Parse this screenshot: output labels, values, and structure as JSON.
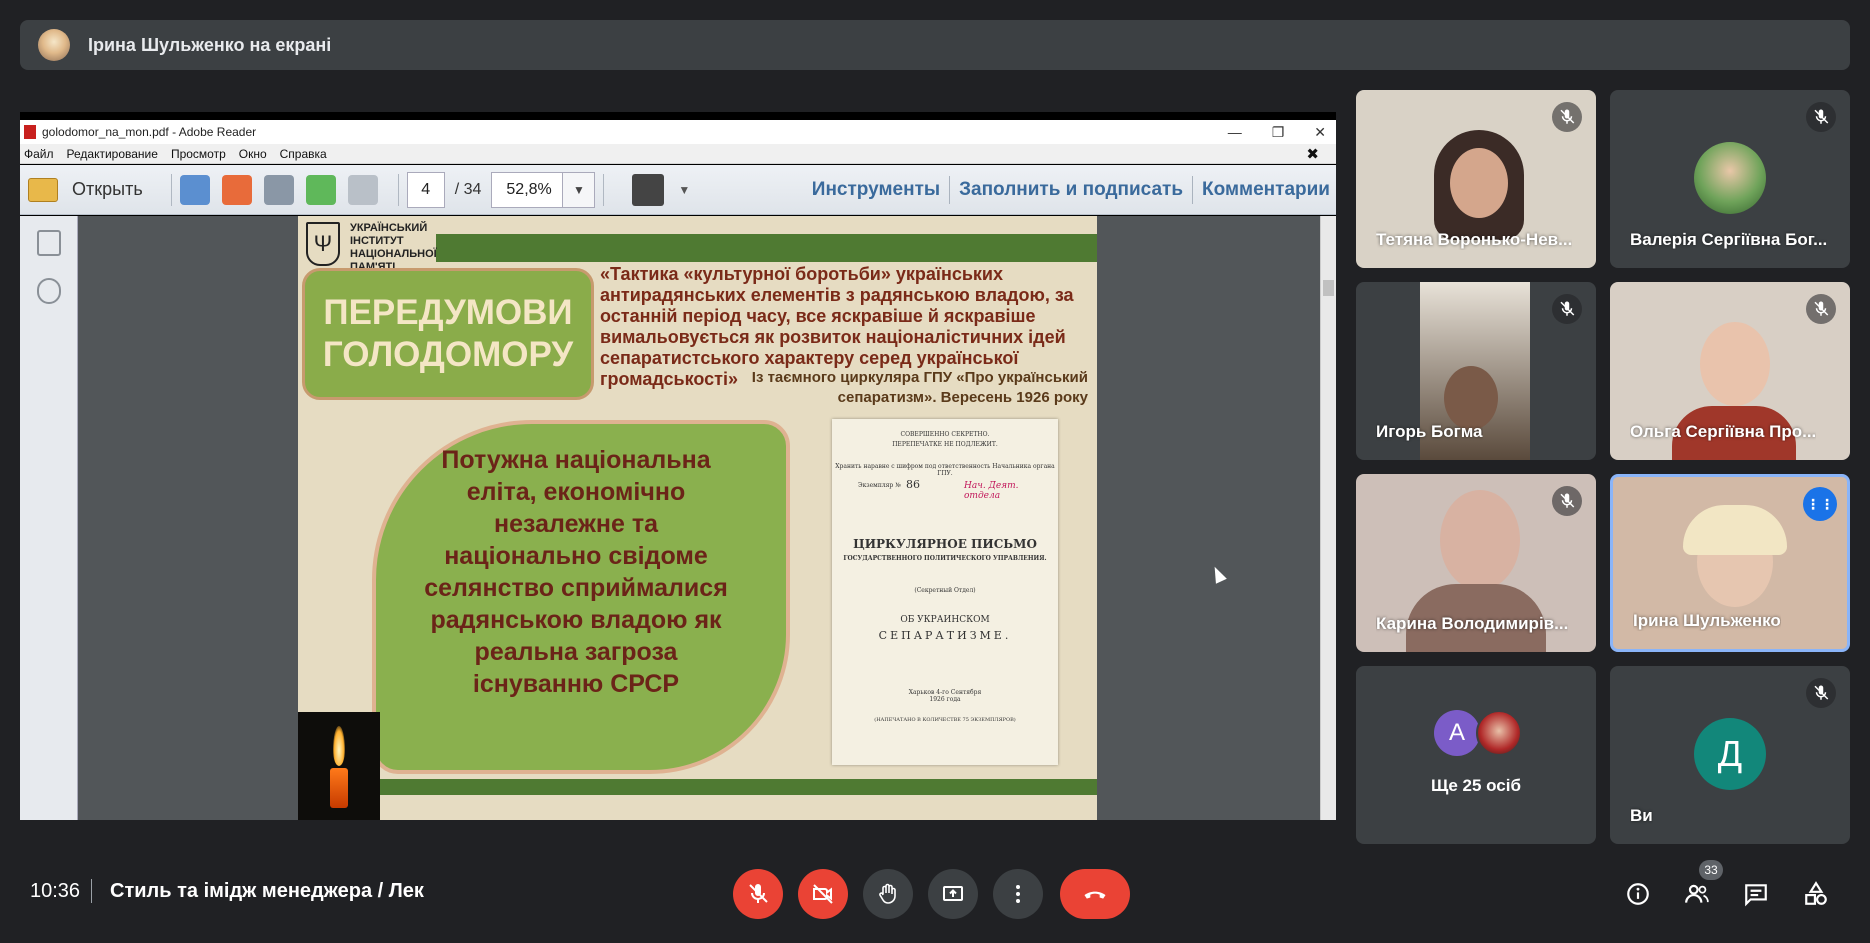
{
  "presenter": {
    "text": "Ірина Шульженко на екрані"
  },
  "reader": {
    "window_title": "golodomor_na_mon.pdf - Adobe Reader",
    "menu": [
      "Файл",
      "Редактирование",
      "Просмотр",
      "Окно",
      "Справка"
    ],
    "open_label": "Открыть",
    "page_current": "4",
    "page_total": "/  34",
    "zoom": "52,8%",
    "tools": [
      "Инструменты",
      "Заполнить и подписать",
      "Комментарии"
    ]
  },
  "slide": {
    "institute": "УКРАЇНСЬКИЙ ІНСТИТУТ НАЦІОНАЛЬНОЇ ПАМ'ЯТІ",
    "title": "ПЕРЕДУМОВИ ГОЛОДОМОРУ",
    "quote": "«Тактика «культурної боротьби» українських антирадянських елементів з радянською владою, за останній період часу, все яскравіше й яскравіше вимальовується як розвиток націоналістичних ідей сепаратистського характеру серед української громадськості»",
    "quote_source": "Із таємного циркуляра ГПУ «Про український сепаратизм». Вересень 1926 року",
    "main_text": "Потужна національна еліта, економічно незалежне та національно свідоме селянство сприймалися радянською владою як реальна загроза існуванню СРСР",
    "doc_lines": {
      "stamp1": "СОВЕРШЕННО СЕКРЕТНО.",
      "stamp2": "ПЕРЕПЕЧАТКЕ НЕ ПОДЛЕЖИТ.",
      "line3": "Хранить наравне с шифром под ответственность Начальника органа ГПУ.",
      "num_label": "Экземпляр №",
      "num": "86",
      "handwritten": "Нач. Деят. отдела",
      "heading1": "ЦИРКУЛЯРНОЕ ПИСЬМО",
      "heading2": "ГОСУДАРСТВЕННОГО ПОЛИТИЧЕСКОГО УПРАВЛЕНИЯ.",
      "dept": "(Секретный Отдел)",
      "about": "ОБ УКРАИНСКОМ",
      "sep": "СЕПАРАТИЗМЕ.",
      "place": "Харьков 4-го Сентября 1926 года",
      "footer": "(НАПЕЧАТАНО В КОЛИЧЕСТВЕ 75 ЭКЗЕМПЛЯРОВ)"
    }
  },
  "participants": [
    {
      "name": "Тетяна Воронько-Нев...",
      "muted": true
    },
    {
      "name": "Валерія Сергіївна Бог...",
      "muted": true
    },
    {
      "name": "Игорь Богма",
      "muted": true
    },
    {
      "name": "Ольга Сергіївна Про...",
      "muted": true
    },
    {
      "name": "Карина Володимирів...",
      "muted": true
    },
    {
      "name": "Ірина Шульженко",
      "muted": false
    },
    {
      "name": "Ще 25 осіб",
      "avatar_letter": "А"
    },
    {
      "name": "Ви",
      "avatar_letter": "Д",
      "muted": true
    }
  ],
  "bottom": {
    "time": "10:36",
    "meeting": "Стиль та імідж менеджера / Лек",
    "people_count": "33"
  },
  "colors": {
    "accent": "#1a73e8",
    "danger": "#ea4335",
    "surface": "#3c4043",
    "background": "#202124"
  }
}
